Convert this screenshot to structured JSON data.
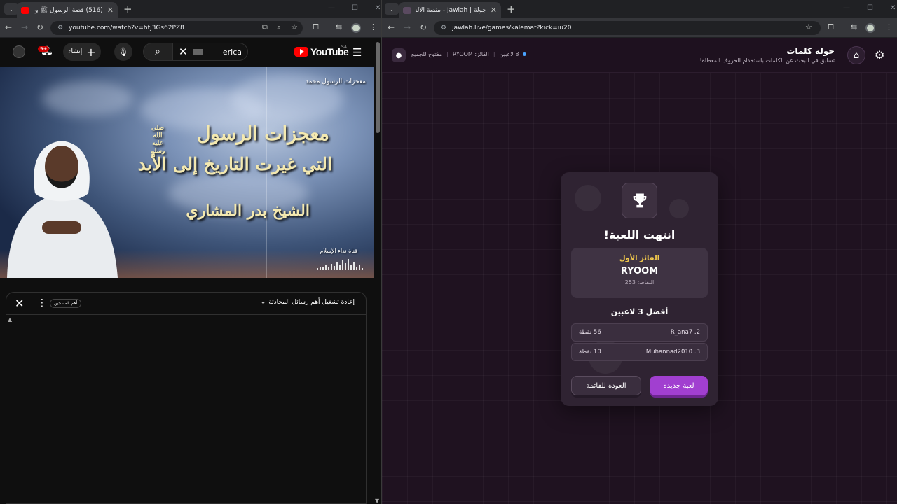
{
  "left_browser": {
    "tab": {
      "title": "(516) قصة الرسول ﷺ وحكايا…"
    },
    "address": "youtube.com/watch?v=htj3Gs62PZ8",
    "youtube": {
      "logo_text": "YouTube",
      "region": "SA",
      "search_value": "erica",
      "create_label": "إنشاء",
      "notif_count": "9+",
      "video": {
        "channel_top": "معجزات الرسول محمد",
        "title_line1": "معجزات الرسول",
        "honorific": "صلى الله عليه وسلم",
        "title_line2": "التي غيرت التاريخ إلى الأبد",
        "speaker": "الشيخ بدر المشاري",
        "channel_bottom": "قناة نداء الإسلام"
      },
      "chat": {
        "title": "إعادة تشغيل أهم رسائل المحادثة",
        "pill": "أهم المسجين"
      }
    }
  },
  "right_browser": {
    "tab": {
      "title": "جولة | Jawlah - منصة الألعاب الذ…"
    },
    "address": "jawlah.live/games/kalemat?kick=iu20",
    "jawlah": {
      "title": "جوله كلمات",
      "subtitle": "تسابق في البحث عن الكلمات باستخدام الحروف المعطاة!",
      "status": {
        "players": "8 لاعبين",
        "winner": "الفائز: RYOOM",
        "access": "مفتوح للجميع"
      },
      "result": {
        "title": "انتهت اللعبة!",
        "winner_label": "الفائز الأول",
        "winner_name": "RYOOM",
        "winner_points": "النقاط: 253",
        "top_label": "أفضل 3 لاعبين",
        "rows": [
          {
            "name": "R_ana7 .2",
            "points": "56 نقطة"
          },
          {
            "name": "Muhannad2010 .3",
            "points": "10 نقطة"
          }
        ],
        "new_game": "لعبة جديدة",
        "back": "العودة للقائمة"
      }
    }
  },
  "colors": {
    "youtube_red": "#ff0000",
    "jawlah_accent": "#a13fd0",
    "winner_gold": "#f2c94c",
    "jawlah_bg": "#1f1220"
  }
}
